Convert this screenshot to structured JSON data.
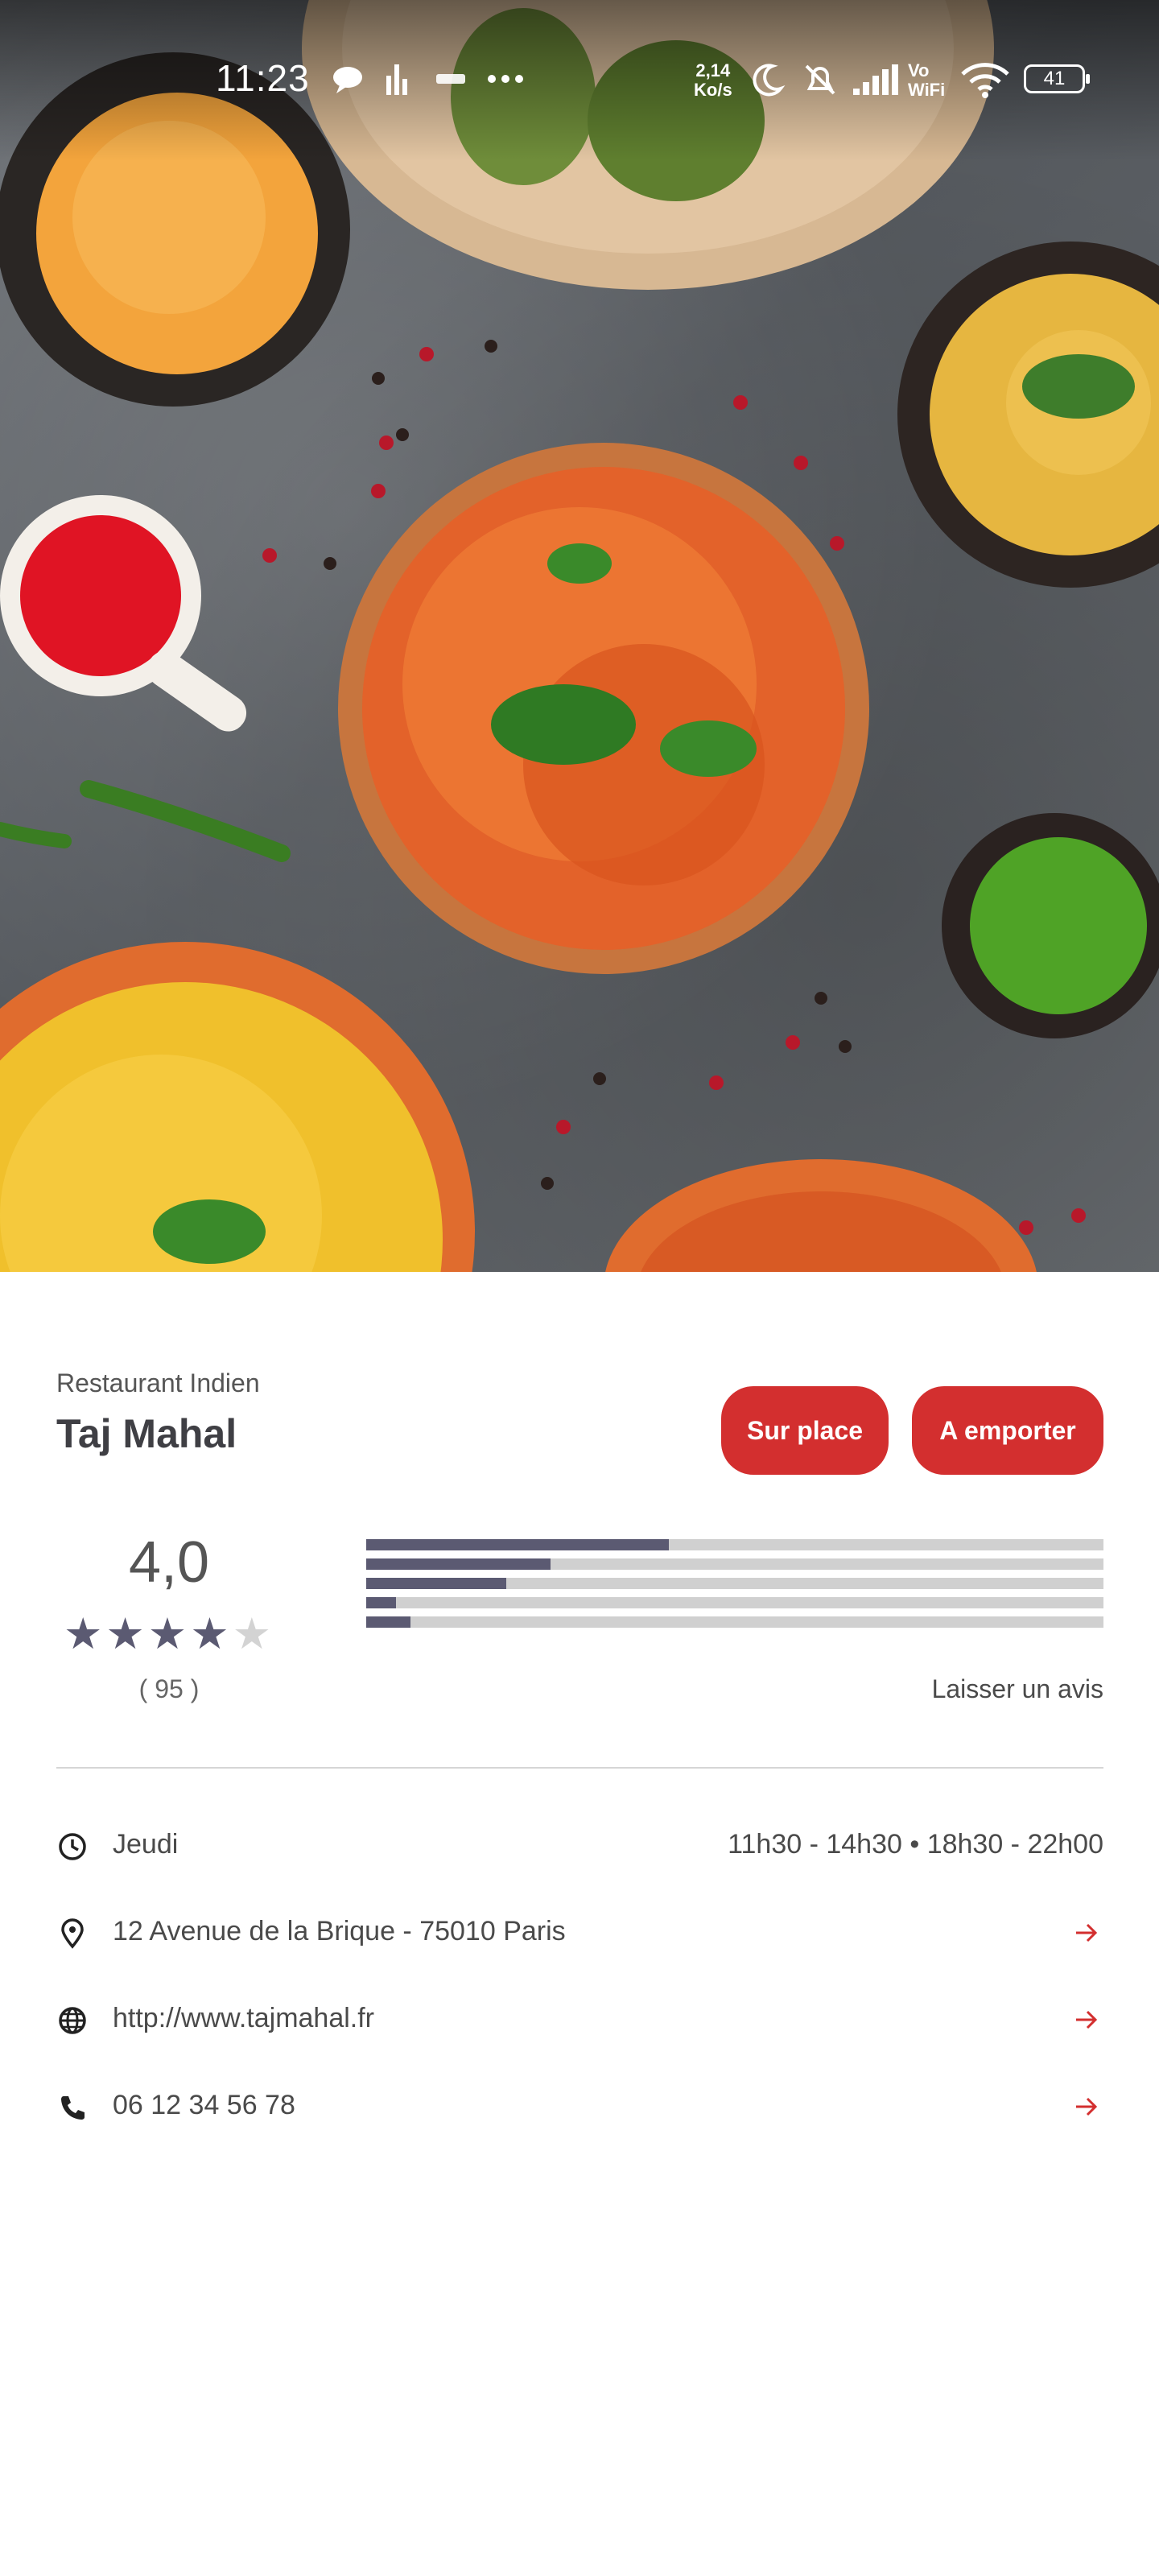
{
  "status_bar": {
    "time": "11:23",
    "speed_value": "2,14",
    "speed_unit": "Ko/s",
    "vowifi_top": "Vo",
    "vowifi_bottom": "WiFi",
    "battery": "41",
    "icons": [
      "chat-bubble-icon",
      "signal-bars-icon",
      "lam-icon",
      "more-dots-icon",
      "moon-icon",
      "bell-off-icon",
      "cell-signal-icon",
      "wifi-icon",
      "battery-icon"
    ]
  },
  "hero": {
    "icon": "food-photo"
  },
  "restaurant": {
    "category": "Restaurant Indien",
    "name": "Taj Mahal"
  },
  "actions": {
    "dine_in": "Sur place",
    "takeaway": "A emporter"
  },
  "rating": {
    "value": "4,0",
    "stars_filled": 4,
    "stars_total": 5,
    "count": "( 95 )",
    "distribution": [
      0.41,
      0.25,
      0.19,
      0.04,
      0.06
    ],
    "leave_review": "Laisser un avis"
  },
  "info": {
    "day": "Jeudi",
    "hours": "11h30 - 14h30 • 18h30 - 22h00",
    "address": "12 Avenue de la Brique - 75010 Paris",
    "website": "http://www.tajmahal.fr",
    "phone": "06 12 34 56 78"
  },
  "colors": {
    "accent": "#d32f2f",
    "bar_fill": "#5b5a72",
    "bar_track": "#d0d0d0",
    "star_off": "#d3d3d3"
  }
}
